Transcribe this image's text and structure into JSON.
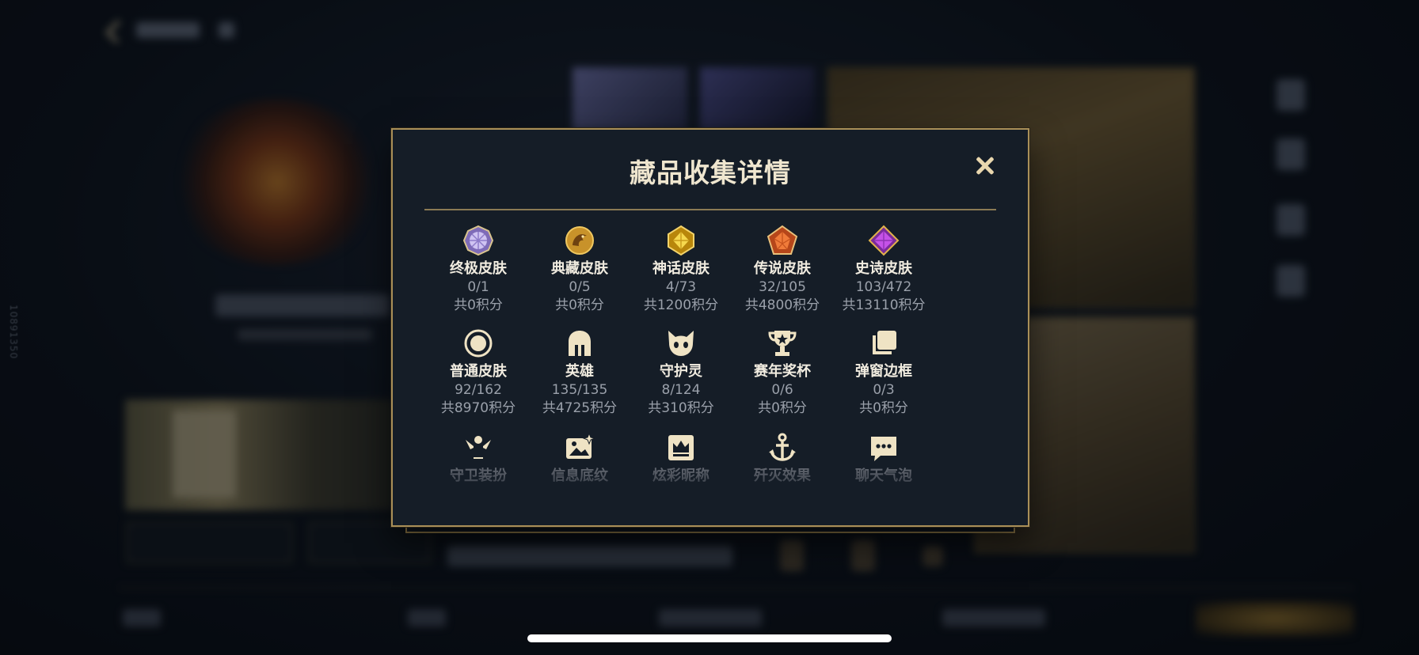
{
  "modal": {
    "title": "藏品收集详情"
  },
  "side_id": "10891350",
  "rows": [
    [
      {
        "name": "终极皮肤",
        "count": "0/1",
        "points": "共0积分",
        "icon": "ultimate-skin-gem-icon"
      },
      {
        "name": "典藏皮肤",
        "count": "0/5",
        "points": "共0积分",
        "icon": "collection-dragon-icon"
      },
      {
        "name": "神话皮肤",
        "count": "4/73",
        "points": "共1200积分",
        "icon": "myth-gem-icon"
      },
      {
        "name": "传说皮肤",
        "count": "32/105",
        "points": "共4800积分",
        "icon": "legend-gem-icon"
      },
      {
        "name": "史诗皮肤",
        "count": "103/472",
        "points": "共13110积分",
        "icon": "epic-gem-icon"
      }
    ],
    [
      {
        "name": "普通皮肤",
        "count": "92/162",
        "points": "共8970积分",
        "icon": "normal-skin-circle-icon"
      },
      {
        "name": "英雄",
        "count": "135/135",
        "points": "共4725积分",
        "icon": "hero-helmet-icon"
      },
      {
        "name": "守护灵",
        "count": "8/124",
        "points": "共310积分",
        "icon": "guardian-spirit-icon"
      },
      {
        "name": "赛年奖杯",
        "count": "0/6",
        "points": "共0积分",
        "icon": "trophy-icon"
      },
      {
        "name": "弹窗边框",
        "count": "0/3",
        "points": "共0积分",
        "icon": "popup-frame-icon"
      }
    ],
    [
      {
        "name": "守卫装扮",
        "icon": "guard-outfit-icon"
      },
      {
        "name": "信息底纹",
        "icon": "info-background-icon"
      },
      {
        "name": "炫彩昵称",
        "icon": "color-nickname-icon"
      },
      {
        "name": "歼灭效果",
        "icon": "annihilate-effect-icon"
      },
      {
        "name": "聊天气泡",
        "icon": "chat-bubble-icon"
      }
    ]
  ],
  "colors": {
    "accent_gold": "#a98f58",
    "modal_bg": "#151d27",
    "title": "#efe6cf",
    "muted": "#9aa0aa"
  }
}
